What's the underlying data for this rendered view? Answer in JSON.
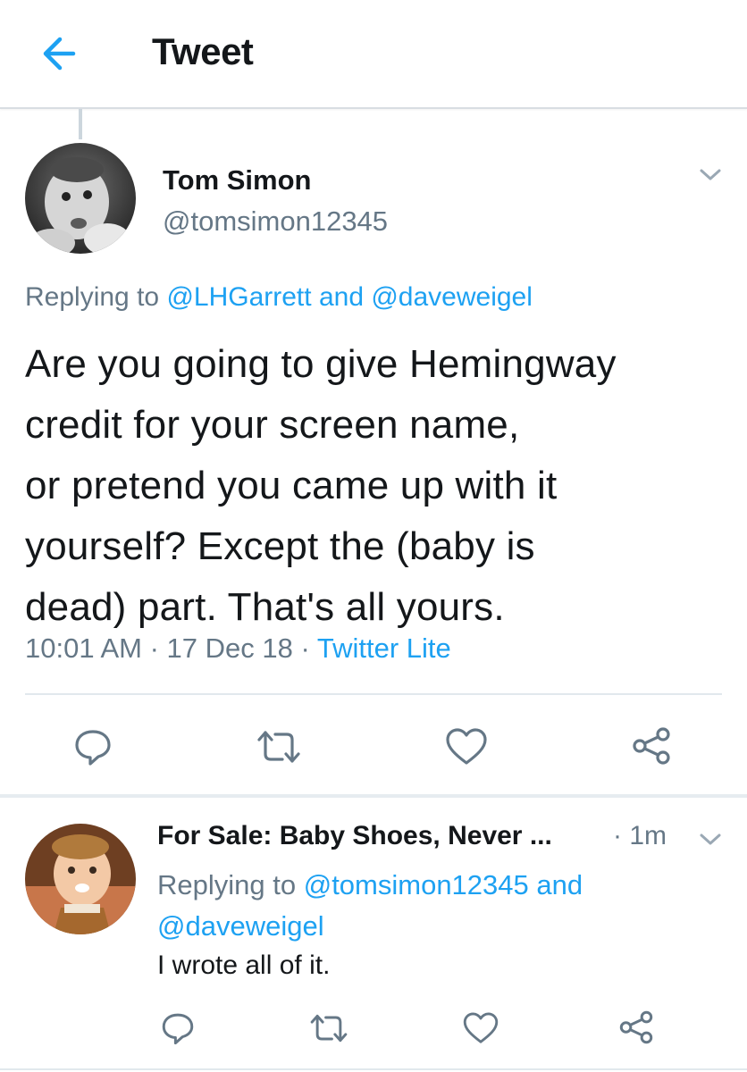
{
  "header": {
    "title": "Tweet",
    "back_icon": "arrow-left-icon"
  },
  "main_tweet": {
    "author_name": "Tom Simon",
    "author_handle": "@tomsimon12345",
    "replying_prefix": "Replying to ",
    "replying_user1": "@LHGarrett",
    "replying_and": " and ",
    "replying_user2": "@daveweigel",
    "text_lines": [
      "Are you going to give Hemingway",
      "credit for your screen name,",
      "or pretend you came up with it",
      "yourself? Except the (baby is",
      "dead) part. That's all yours."
    ],
    "time": "10:01 AM",
    "sep": " · ",
    "date": "17 Dec 18",
    "source": "Twitter Lite"
  },
  "reply_tweet": {
    "author_name": "For Sale: Baby Shoes, Never ...",
    "time": "· 1m",
    "replying_prefix": "Replying to ",
    "replying_user1": "@tomsimon12345",
    "replying_and": " and ",
    "replying_user2": "@daveweigel",
    "text": "I wrote all of it."
  },
  "icons": [
    "reply-icon",
    "retweet-icon",
    "like-icon",
    "share-icon",
    "chevron-down-icon"
  ],
  "colors": {
    "accent": "#1da1f2",
    "secondary_text": "#657786",
    "icon": "#657786"
  }
}
